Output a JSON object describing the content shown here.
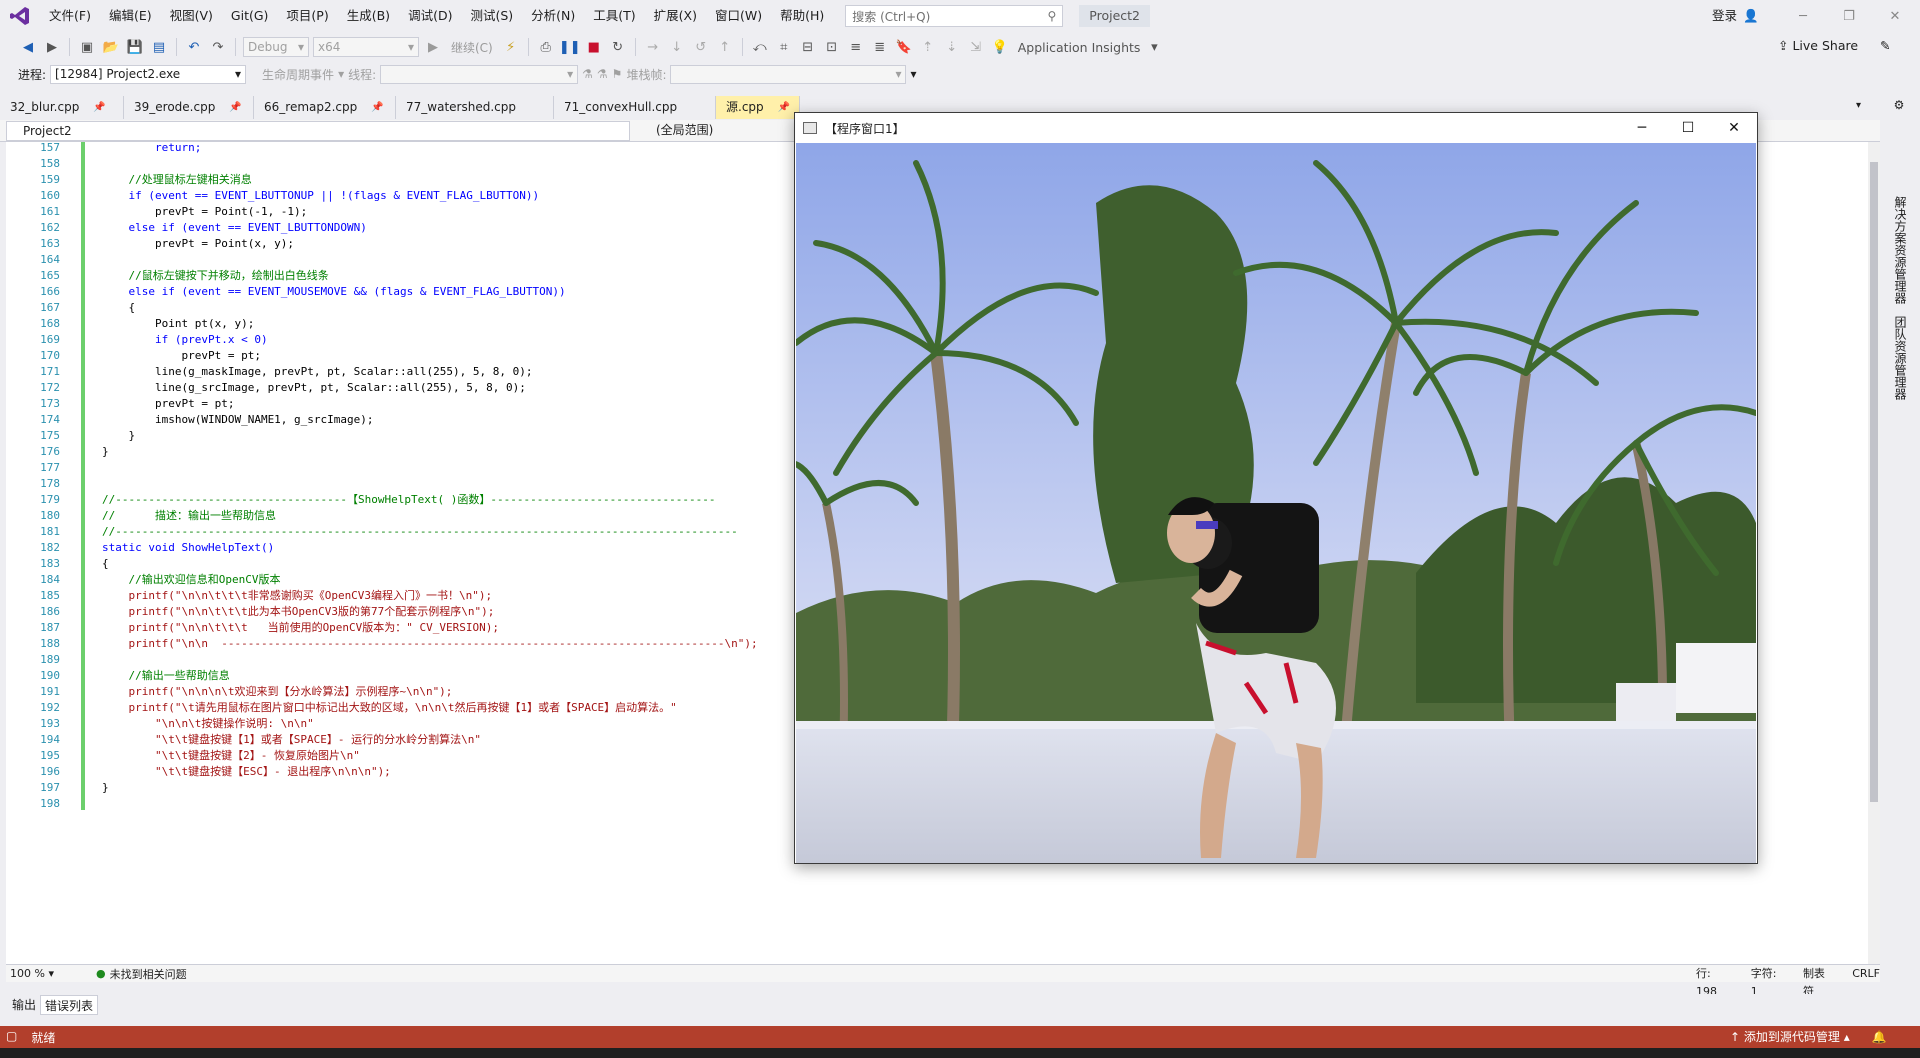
{
  "menu": [
    "文件(F)",
    "编辑(E)",
    "视图(V)",
    "Git(G)",
    "项目(P)",
    "生成(B)",
    "调试(D)",
    "测试(S)",
    "分析(N)",
    "工具(T)",
    "扩展(X)",
    "窗口(W)",
    "帮助(H)"
  ],
  "search": {
    "placeholder": "搜索 (Ctrl+Q)"
  },
  "project_title": "Project2",
  "signin": "登录",
  "toolbar": {
    "config": "Debug",
    "platform": "x64",
    "continue_label": "继续(C)",
    "app_insights": "Application Insights",
    "live_share": "Live Share"
  },
  "debugbar": {
    "process_label": "进程:",
    "process_value": "[12984] Project2.exe",
    "lifecycle_label": "生命周期事件",
    "thread_label": "线程:",
    "stackframe_label": "堆栈帧:"
  },
  "tabs": [
    {
      "label": "32_blur.cpp"
    },
    {
      "label": "39_erode.cpp"
    },
    {
      "label": "66_remap2.cpp"
    },
    {
      "label": "77_watershed.cpp"
    },
    {
      "label": "71_convexHull.cpp"
    },
    {
      "label": "源.cpp",
      "active": true
    }
  ],
  "navbar": {
    "project": "Project2",
    "scope": "(全局范围)"
  },
  "code_lines": [
    {
      "n": "157",
      "code": "        return;"
    },
    {
      "n": "158",
      "code": ""
    },
    {
      "n": "159",
      "code": "    //处理鼠标左键相关消息"
    },
    {
      "n": "160",
      "code": "    if (event == EVENT_LBUTTONUP || !(flags & EVENT_FLAG_LBUTTON))"
    },
    {
      "n": "161",
      "code": "        prevPt = Point(-1, -1);"
    },
    {
      "n": "162",
      "code": "    else if (event == EVENT_LBUTTONDOWN)"
    },
    {
      "n": "163",
      "code": "        prevPt = Point(x, y);"
    },
    {
      "n": "164",
      "code": ""
    },
    {
      "n": "165",
      "code": "    //鼠标左键按下并移动，绘制出白色线条"
    },
    {
      "n": "166",
      "code": "    else if (event == EVENT_MOUSEMOVE && (flags & EVENT_FLAG_LBUTTON))"
    },
    {
      "n": "167",
      "code": "    {"
    },
    {
      "n": "168",
      "code": "        Point pt(x, y);"
    },
    {
      "n": "169",
      "code": "        if (prevPt.x < 0)"
    },
    {
      "n": "170",
      "code": "            prevPt = pt;"
    },
    {
      "n": "171",
      "code": "        line(g_maskImage, prevPt, pt, Scalar::all(255), 5, 8, 0);"
    },
    {
      "n": "172",
      "code": "        line(g_srcImage, prevPt, pt, Scalar::all(255), 5, 8, 0);"
    },
    {
      "n": "173",
      "code": "        prevPt = pt;"
    },
    {
      "n": "174",
      "code": "        imshow(WINDOW_NAME1, g_srcImage);"
    },
    {
      "n": "175",
      "code": "    }"
    },
    {
      "n": "176",
      "code": "}"
    },
    {
      "n": "177",
      "code": ""
    },
    {
      "n": "178",
      "code": ""
    },
    {
      "n": "179",
      "code": "//-----------------------------------【ShowHelpText( )函数】----------------------------------"
    },
    {
      "n": "180",
      "code": "//      描述：输出一些帮助信息"
    },
    {
      "n": "181",
      "code": "//----------------------------------------------------------------------------------------------"
    },
    {
      "n": "182",
      "code": "static void ShowHelpText()"
    },
    {
      "n": "183",
      "code": "{"
    },
    {
      "n": "184",
      "code": "    //输出欢迎信息和OpenCV版本"
    },
    {
      "n": "185",
      "code": "    printf(\"\\n\\n\\t\\t\\t非常感谢购买《OpenCV3编程入门》一书！\\n\");"
    },
    {
      "n": "186",
      "code": "    printf(\"\\n\\n\\t\\t\\t此为本书OpenCV3版的第77个配套示例程序\\n\");"
    },
    {
      "n": "187",
      "code": "    printf(\"\\n\\n\\t\\t\\t   当前使用的OpenCV版本为：\" CV_VERSION);"
    },
    {
      "n": "188",
      "code": "    printf(\"\\n\\n  ----------------------------------------------------------------------------\\n\");"
    },
    {
      "n": "189",
      "code": ""
    },
    {
      "n": "190",
      "code": "    //输出一些帮助信息"
    },
    {
      "n": "191",
      "code": "    printf(\"\\n\\n\\n\\t欢迎来到【分水岭算法】示例程序~\\n\\n\");"
    },
    {
      "n": "192",
      "code": "    printf(\"\\t请先用鼠标在图片窗口中标记出大致的区域，\\n\\n\\t然后再按键【1】或者【SPACE】启动算法。\""
    },
    {
      "n": "193",
      "code": "        \"\\n\\n\\t按键操作说明: \\n\\n\""
    },
    {
      "n": "194",
      "code": "        \"\\t\\t键盘按键【1】或者【SPACE】- 运行的分水岭分割算法\\n\""
    },
    {
      "n": "195",
      "code": "        \"\\t\\t键盘按键【2】- 恢复原始图片\\n\""
    },
    {
      "n": "196",
      "code": "        \"\\t\\t键盘按键【ESC】- 退出程序\\n\\n\\n\");"
    },
    {
      "n": "197",
      "code": "}"
    },
    {
      "n": "198",
      "code": ""
    }
  ],
  "editor_status": {
    "zoom": "100 %",
    "issues": "未找到相关问题",
    "line": "行: 198",
    "col": "字符: 1",
    "indent": "制表符",
    "eol": "CRLF"
  },
  "right_dock": [
    "解决方案资源管理器",
    "团队资源管理器"
  ],
  "panel_tabs": [
    "输出",
    "错误列表"
  ],
  "statusbar": {
    "ready": "就绪",
    "source_control": "添加到源代码管理"
  },
  "image_window": {
    "title": "【程序窗口1】"
  },
  "colors": {
    "statusbar": "#b23f2c",
    "active_tab": "#fff0aa",
    "change_bar": "#6ccf6c"
  }
}
